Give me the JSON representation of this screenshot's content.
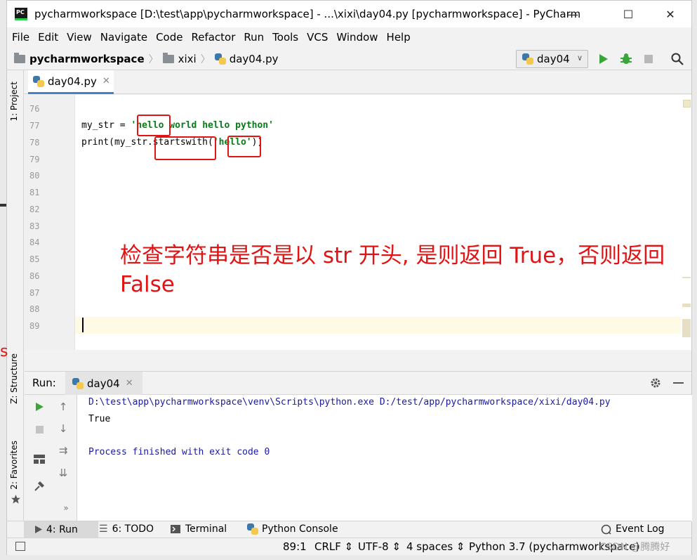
{
  "window": {
    "title": "pycharmworkspace [D:\\test\\app\\pycharmworkspace] - ...\\xixi\\day04.py [pycharmworkspace] - PyCharm",
    "logo_text": "PC",
    "minimize": "—",
    "maximize": "☐",
    "close": "✕"
  },
  "menu": [
    "File",
    "Edit",
    "View",
    "Navigate",
    "Code",
    "Refactor",
    "Run",
    "Tools",
    "VCS",
    "Window",
    "Help"
  ],
  "breadcrumb": {
    "project": "pycharmworkspace",
    "folder": "xixi",
    "file": "day04.py"
  },
  "run_config": {
    "label": "day04"
  },
  "side_tools": {
    "project": "1: Project",
    "structure": "Z: Structure",
    "favorites": "2: Favorites"
  },
  "editor": {
    "tab_label": "day04.py",
    "lines": [
      {
        "num": "76",
        "code": ""
      },
      {
        "num": "77",
        "code": "my_str = 'hello world hello python'"
      },
      {
        "num": "78",
        "code": "print(my_str.startswith('hello'))"
      },
      {
        "num": "79",
        "code": ""
      },
      {
        "num": "80",
        "code": ""
      },
      {
        "num": "81",
        "code": ""
      },
      {
        "num": "82",
        "code": ""
      },
      {
        "num": "83",
        "code": ""
      },
      {
        "num": "84",
        "code": ""
      },
      {
        "num": "85",
        "code": ""
      },
      {
        "num": "86",
        "code": ""
      },
      {
        "num": "87",
        "code": ""
      },
      {
        "num": "88",
        "code": ""
      },
      {
        "num": "89",
        "code": ""
      }
    ],
    "annotation": "检查字符串是否是以 str 开头, 是则返回 True，否则返回 False"
  },
  "run_panel": {
    "title": "Run:",
    "tab_label": "day04",
    "output": [
      "D:\\test\\app\\pycharmworkspace\\venv\\Scripts\\python.exe D:/test/app/pycharmworkspace/xixi/day04.py",
      "True",
      "",
      "Process finished with exit code 0"
    ]
  },
  "bottom_tools": {
    "run": "4: Run",
    "todo": "6: TODO",
    "terminal": "Terminal",
    "python_console": "Python Console",
    "event_log": "Event Log"
  },
  "status": {
    "position": "89:1",
    "line_sep": "CRLF",
    "encoding": "UTF-8",
    "indent": "4 spaces",
    "interpreter": "Python 3.7 (pycharmworkspace)"
  },
  "watermark": "CSDN @腾腾好"
}
